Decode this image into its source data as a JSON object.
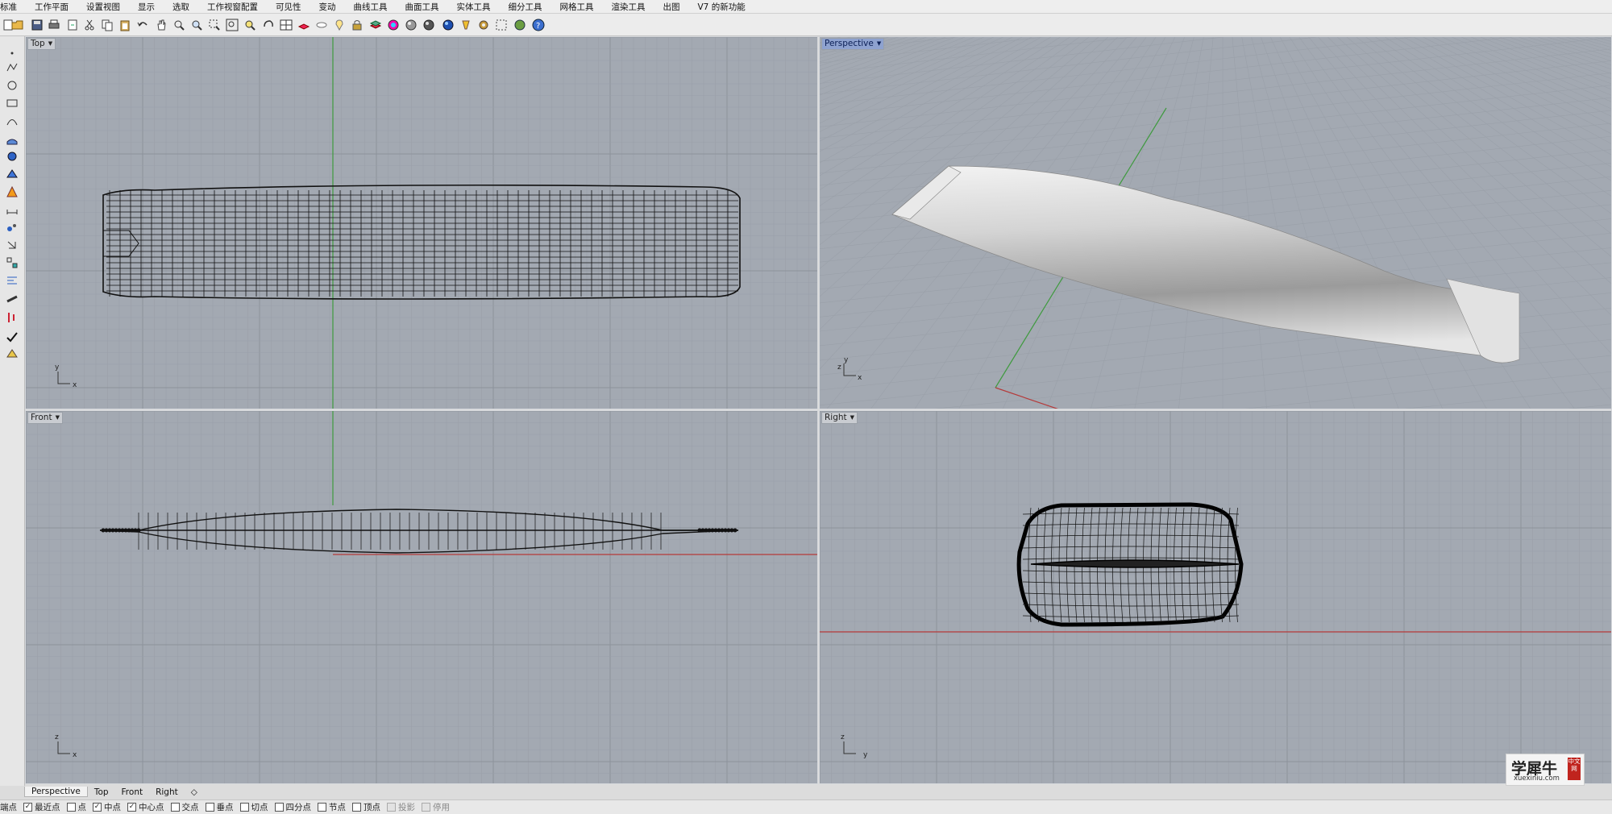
{
  "menu": [
    "标准",
    "工作平面",
    "设置视图",
    "显示",
    "选取",
    "工作视窗配置",
    "可见性",
    "变动",
    "曲线工具",
    "曲面工具",
    "实体工具",
    "细分工具",
    "网格工具",
    "渲染工具",
    "出图",
    "V7 的新功能"
  ],
  "toolbar_icons": [
    "new-icon",
    "open-icon",
    "save-icon",
    "print-icon",
    "import-icon",
    "cut-icon",
    "copy-icon",
    "paste-icon",
    "undo-icon",
    "pan-hand-icon",
    "zoom-dynamic-icon",
    "zoom-in-icon",
    "zoom-window-icon",
    "zoom-extents-icon",
    "zoom-selected-icon",
    "rotate-view-icon",
    "four-viewports-icon",
    "cplane-icon",
    "hide-icon",
    "show-icon",
    "lock-icon",
    "layer-icon",
    "color-wheel-icon",
    "material-sphere-icon",
    "render-sphere-icon",
    "blue-sphere-icon",
    "light-icon",
    "gear-options-icon",
    "grid-snap-icon",
    "globe-render-icon",
    "help-icon"
  ],
  "left_tools": [
    "point-icon",
    "polyline-icon",
    "circle-icon",
    "rectangle-icon",
    "curve-icon",
    "surface-icon",
    "solid-icon",
    "mesh-icon",
    "explode-icon",
    "dimension-icon",
    "analyze-icon",
    "transform-icon",
    "array-icon",
    "align-icon",
    "text-icon",
    "measure-icon",
    "check-icon",
    "render-icon"
  ],
  "viewports": {
    "top": {
      "label": "Top",
      "axis_a": "y",
      "axis_b": "x"
    },
    "perspective": {
      "label": "Perspective",
      "axis_a": "y",
      "axis_b": "x",
      "axis_c": "z"
    },
    "front": {
      "label": "Front",
      "axis_a": "z",
      "axis_b": "x"
    },
    "right": {
      "label": "Right",
      "axis_a": "z",
      "axis_b": "y"
    }
  },
  "tabs": [
    "Perspective",
    "Top",
    "Front",
    "Right"
  ],
  "tabs_add": "◇",
  "osnaps": [
    {
      "label": "端点",
      "state": "label-only"
    },
    {
      "label": "最近点",
      "state": "on"
    },
    {
      "label": "点",
      "state": "off"
    },
    {
      "label": "中点",
      "state": "on"
    },
    {
      "label": "中心点",
      "state": "on"
    },
    {
      "label": "交点",
      "state": "off"
    },
    {
      "label": "垂点",
      "state": "off"
    },
    {
      "label": "切点",
      "state": "off"
    },
    {
      "label": "四分点",
      "state": "off"
    },
    {
      "label": "节点",
      "state": "off"
    },
    {
      "label": "顶点",
      "state": "off"
    },
    {
      "label": "投影",
      "state": "disabled"
    },
    {
      "label": "停用",
      "state": "disabled"
    }
  ],
  "watermark": {
    "name": "学犀牛",
    "url": "xuexiniu.com",
    "seal": "中文网"
  },
  "colors": {
    "viewport_bg": "#a3a9b2",
    "grid_minor": "#9aa0a9",
    "grid_major": "#8c929b",
    "x_axis": "#b53a3a",
    "y_axis": "#3f9a3f",
    "active_label": "#8ea2cf"
  }
}
